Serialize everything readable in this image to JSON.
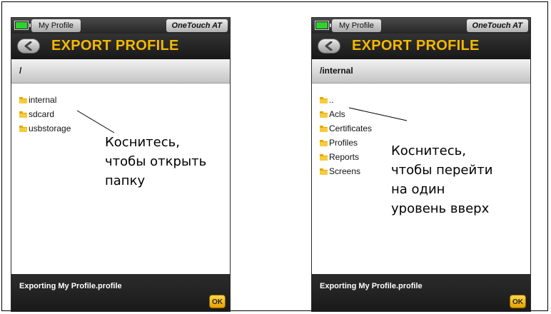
{
  "screens": [
    {
      "status_bar": {
        "battery_icon": "battery-full-icon",
        "profile_tab": "My Profile",
        "brand": "OneTouch AT"
      },
      "title": "EXPORT PROFILE",
      "back_icon": "back-arrow-icon",
      "path": "/",
      "files": [
        "internal",
        "sdcard",
        "usbstorage"
      ],
      "footer_status": "Exporting My Profile.profile",
      "ok_label": "OK"
    },
    {
      "status_bar": {
        "battery_icon": "battery-full-icon",
        "profile_tab": "My Profile",
        "brand": "OneTouch AT"
      },
      "title": "EXPORT PROFILE",
      "back_icon": "back-arrow-icon",
      "path": "/internal",
      "files": [
        "..",
        "Acls",
        "Certificates",
        "Profiles",
        "Reports",
        "Screens"
      ],
      "footer_status": "Exporting My Profile.profile",
      "ok_label": "OK"
    }
  ],
  "callouts": {
    "left": [
      "Коснитесь,",
      "чтобы открыть",
      "папку"
    ],
    "right": [
      "Коснитесь,",
      "чтобы перейти",
      "на один",
      "уровень вверх"
    ]
  },
  "colors": {
    "title_accent": "#f5b800",
    "battery_green": "#2fd12f",
    "folder_yellow": "#f6cb3c",
    "ok_button": "#f0b800"
  }
}
